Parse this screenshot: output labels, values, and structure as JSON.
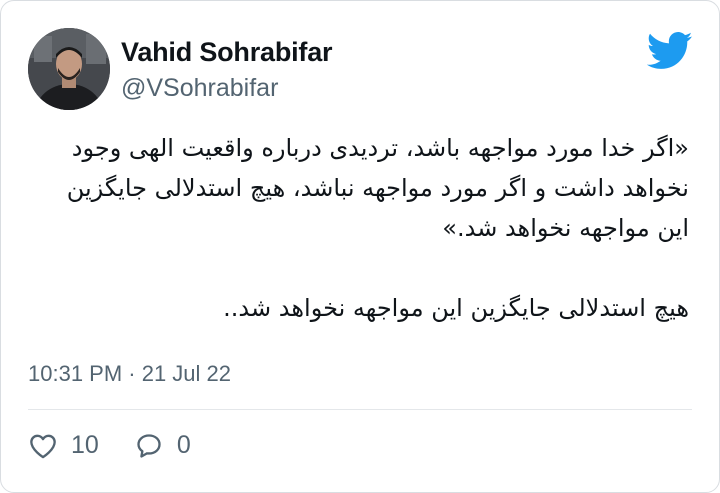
{
  "author": {
    "display_name": "Vahid Sohrabifar",
    "handle": "@VSohrabifar",
    "avatar_icon": "profile-photo"
  },
  "brand": {
    "icon": "twitter-bird-icon",
    "color": "#1d9bf0"
  },
  "tweet": {
    "paragraph_1": "«اگر خدا مورد مواجهه باشد، تردیدی درباره واقعیت الهی وجود نخواهد داشت و اگر مورد مواجهه نباشد، هیچ استدلالی جایگزین این مواجهه نخواهد شد.»",
    "paragraph_2": "هیچ استدلالی جایگزین این مواجهه نخواهد شد..",
    "timestamp": "10:31 PM · 21 Jul 22"
  },
  "actions": {
    "like_icon": "heart-icon",
    "like_count": "10",
    "reply_icon": "reply-bubble-icon",
    "reply_count": "0"
  }
}
